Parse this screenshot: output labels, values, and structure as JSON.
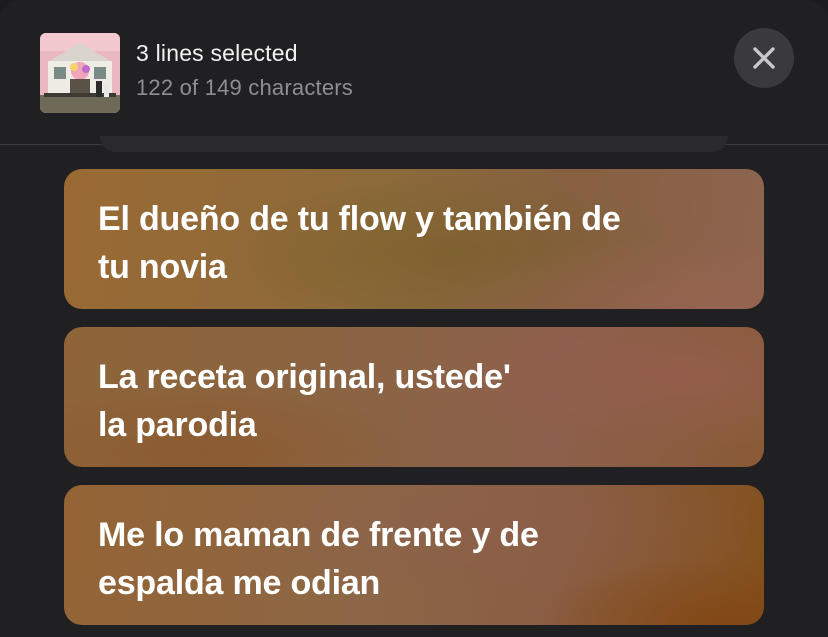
{
  "header": {
    "title": "3 lines selected",
    "subtitle": "122 of 149 characters",
    "artwork_icon": "album-artwork",
    "close_icon": "close-icon"
  },
  "lyrics": [
    {
      "lines": [
        "El dueño de tu flow y también de",
        "tu novia"
      ]
    },
    {
      "lines": [
        "La receta original, ustede'",
        "la parodia"
      ]
    },
    {
      "lines": [
        "Me lo maman de frente y de",
        "espalda me odian"
      ]
    }
  ],
  "colors": {
    "background": "#202022",
    "card_tint": "#8c6440",
    "close_button": "#3a3a3c"
  }
}
